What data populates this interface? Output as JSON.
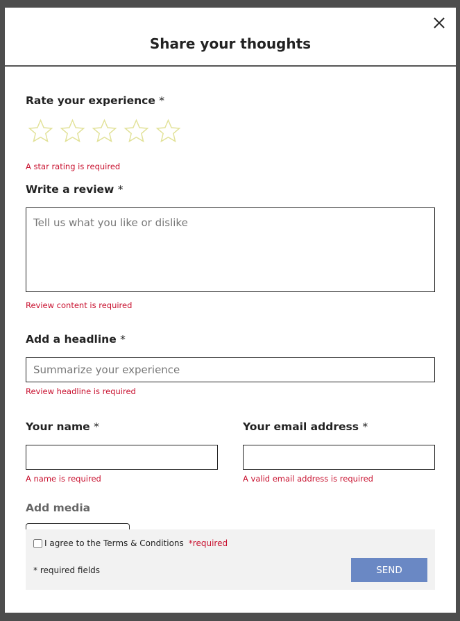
{
  "modal": {
    "title": "Share your thoughts",
    "close_icon": "close-icon"
  },
  "rating": {
    "label": "Rate your experience",
    "required_mark": "*",
    "stars": 5,
    "selected": 0,
    "star_color": "#e2e29a",
    "error": "A star rating is required"
  },
  "review": {
    "label": "Write a review",
    "required_mark": "*",
    "placeholder": "Tell us what you like or dislike",
    "value": "",
    "error": "Review content is required"
  },
  "headline": {
    "label": "Add a headline",
    "required_mark": "*",
    "placeholder": "Summarize your experience",
    "value": "",
    "error": "Review headline is required"
  },
  "name": {
    "label": "Your name",
    "required_mark": "*",
    "value": "",
    "error": "A name is required"
  },
  "email": {
    "label": "Your email address",
    "required_mark": "*",
    "value": "",
    "error": "A valid email address is required"
  },
  "media": {
    "label": "Add media"
  },
  "footer": {
    "terms_label": "I agree to the Terms & Conditions",
    "terms_required": "*required",
    "required_note": "* required fields",
    "send_label": "SEND",
    "send_color": "#6a88c4"
  },
  "colors": {
    "error": "#c8102e",
    "backdrop": "#4d4d4d"
  }
}
